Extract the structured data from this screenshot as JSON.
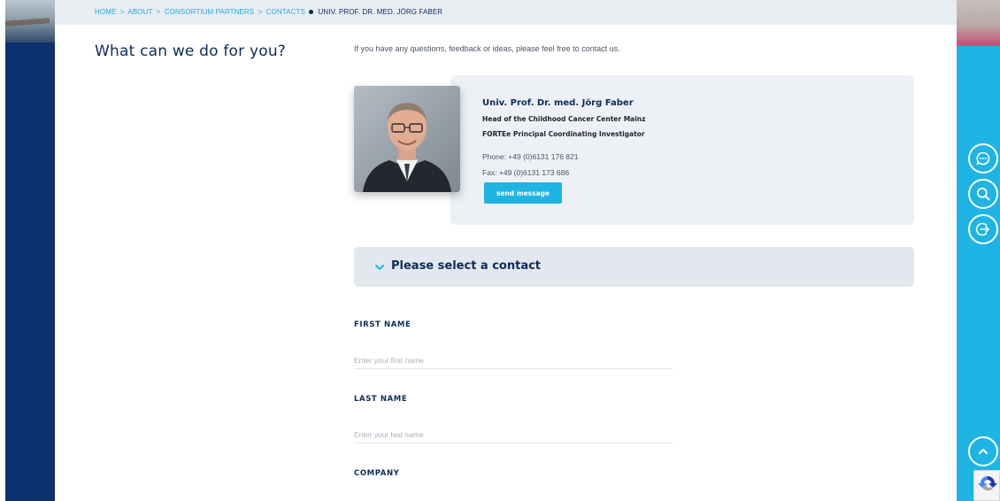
{
  "breadcrumb": {
    "items": [
      "HOME",
      "ABOUT",
      "CONSORTIUM PARTNERS",
      "CONTACTS"
    ],
    "separator": ">",
    "current": "UNIV. PROF. DR. MED. JÖRG FABER"
  },
  "page": {
    "title": "What can we do for you?",
    "intro": "If you have any questions, feedback or ideas, please feel free to contact us."
  },
  "contact": {
    "name": "Univ. Prof. Dr. med. Jörg Faber",
    "role1": "Head of the Childhood Cancer Center Mainz",
    "role2": "FORTEe Principal Coordinating Investigator",
    "phone": "Phone: +49 (0)6131 176 821",
    "fax": "Fax: +49 (0)6131 173 686",
    "send_label": "send message"
  },
  "select": {
    "label": "Please select a contact"
  },
  "form": {
    "first_name_label": "FIRST NAME",
    "first_name_placeholder": "Enter your first name",
    "last_name_label": "LAST NAME",
    "last_name_placeholder": "Enter your last name",
    "company_label": "COMPANY"
  },
  "side_actions": [
    "chat-icon",
    "search-icon",
    "login-icon"
  ],
  "colors": {
    "navy": "#0d3270",
    "cyan": "#1eb4e4",
    "text": "#0c2c5a",
    "card": "#edf1f5"
  }
}
